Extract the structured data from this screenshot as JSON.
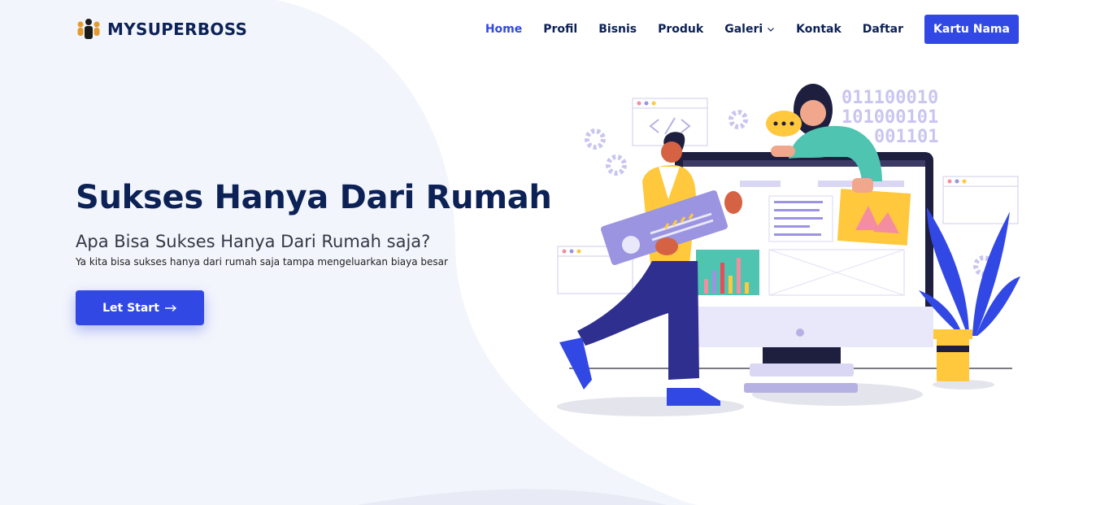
{
  "brand": {
    "name": "MYSUPERBOSS"
  },
  "nav": {
    "items": [
      {
        "label": "Home",
        "active": true
      },
      {
        "label": "Profil"
      },
      {
        "label": "Bisnis"
      },
      {
        "label": "Produk"
      },
      {
        "label": "Galeri",
        "has_dropdown": true
      },
      {
        "label": "Kontak"
      },
      {
        "label": "Daftar"
      }
    ],
    "cta_label": "Kartu Nama"
  },
  "hero": {
    "title": "Sukses Hanya Dari Rumah",
    "subtitle": "Apa Bisa Sukses Hanya Dari Rumah saja?",
    "description": "Ya kita bisa sukses hanya dari rumah saja tampa mengeluarkan biaya besar",
    "button_label": "Let Start",
    "button_icon": "arrow-right-icon"
  },
  "illustration": {
    "binary_lines": [
      "011100010",
      "101000101",
      "001101"
    ]
  },
  "colors": {
    "accent": "#3248e4",
    "navy": "#0c2155",
    "lavender": "#c9c5f0"
  }
}
